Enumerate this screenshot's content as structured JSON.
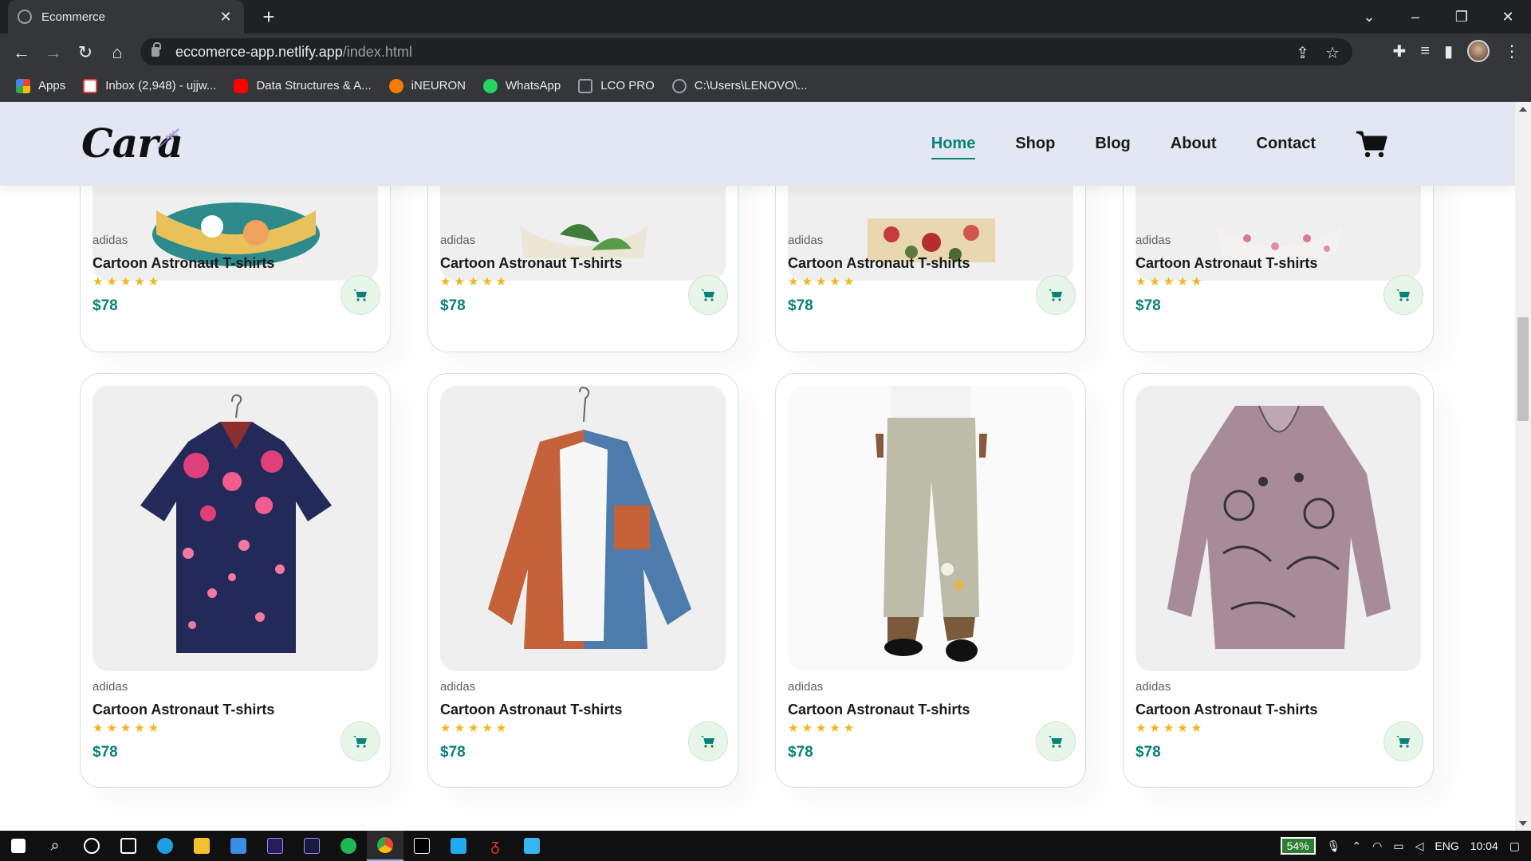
{
  "browser": {
    "tab_title": "Ecommerce",
    "tab_close": "✕",
    "new_tab": "+",
    "url_host": "eccomerce-app.netlify.app",
    "url_path": "/index.html",
    "bookmarks": [
      {
        "label": "Apps",
        "icon": "apps-grid-icon",
        "color": "#4285f4"
      },
      {
        "label": "Inbox (2,948) - ujjw...",
        "icon": "gmail-icon",
        "color": "#ea4335"
      },
      {
        "label": "Data Structures & A...",
        "icon": "youtube-icon",
        "color": "#ff0000"
      },
      {
        "label": "iNEURON",
        "icon": "ineuron-icon",
        "color": "#f57c00"
      },
      {
        "label": "WhatsApp",
        "icon": "whatsapp-icon",
        "color": "#25d366"
      },
      {
        "label": "LCO PRO",
        "icon": "lco-icon",
        "color": "#9aa0a6"
      },
      {
        "label": "C:\\Users\\LENOVO\\...",
        "icon": "globe-icon",
        "color": "#9aa0a6"
      }
    ]
  },
  "site": {
    "logo": "Cara",
    "nav": [
      {
        "label": "Home",
        "active": true
      },
      {
        "label": "Shop",
        "active": false
      },
      {
        "label": "Blog",
        "active": false
      },
      {
        "label": "About",
        "active": false
      },
      {
        "label": "Contact",
        "active": false
      }
    ]
  },
  "products_top_row": [
    {
      "brand": "adidas",
      "name": "Cartoon Astronaut T-shirts",
      "stars": "★★★★★",
      "price": "$78",
      "image": "astronaut-tshirt-image"
    },
    {
      "brand": "adidas",
      "name": "Cartoon Astronaut T-shirts",
      "stars": "★★★★★",
      "price": "$78",
      "image": "leaf-print-shirt-image"
    },
    {
      "brand": "adidas",
      "name": "Cartoon Astronaut T-shirts",
      "stars": "★★★★★",
      "price": "$78",
      "image": "floral-shirt-image"
    },
    {
      "brand": "adidas",
      "name": "Cartoon Astronaut T-shirts",
      "stars": "★★★★★",
      "price": "$78",
      "image": "pink-floral-shirt-image"
    }
  ],
  "products_bottom_row": [
    {
      "brand": "adidas",
      "name": "Cartoon Astronaut T-shirts",
      "stars": "★★★★★",
      "price": "$78",
      "image": "navy-rose-shirt-image"
    },
    {
      "brand": "adidas",
      "name": "Cartoon Astronaut T-shirts",
      "stars": "★★★★★",
      "price": "$78",
      "image": "orange-blue-corduroy-shirt-image"
    },
    {
      "brand": "adidas",
      "name": "Cartoon Astronaut T-shirts",
      "stars": "★★★★★",
      "price": "$78",
      "image": "linen-trousers-image"
    },
    {
      "brand": "adidas",
      "name": "Cartoon Astronaut T-shirts",
      "stars": "★★★★★",
      "price": "$78",
      "image": "cat-print-blouse-image"
    }
  ],
  "taskbar": {
    "battery": "54%",
    "language": "ENG",
    "time": "10:04"
  },
  "colors": {
    "accent": "#088178",
    "header_bg": "#e3e6f3",
    "card_border": "#cce7d0",
    "star": "#f3b519"
  }
}
